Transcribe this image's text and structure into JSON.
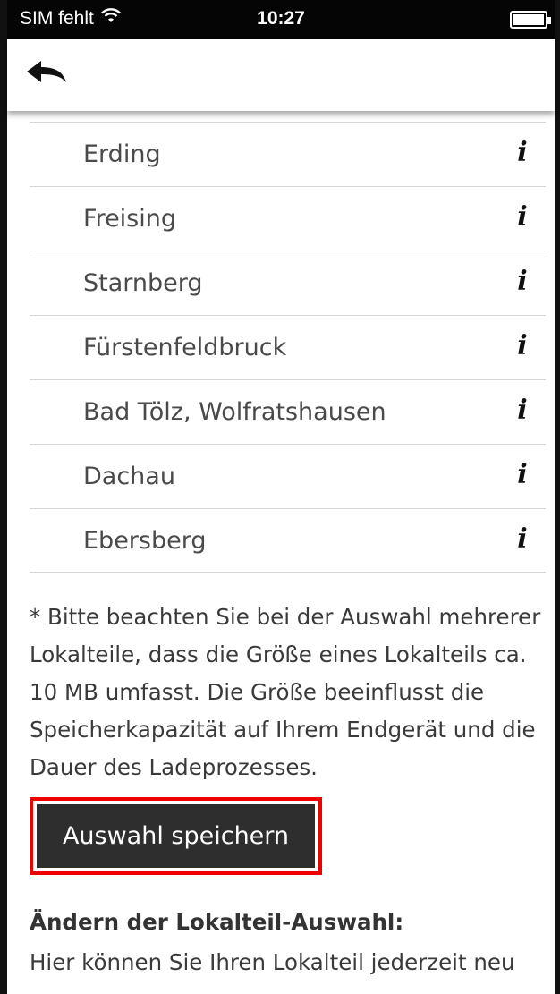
{
  "status_bar": {
    "carrier": "SIM fehlt",
    "time": "10:27"
  },
  "nav": {
    "back_icon": "back-arrow-icon"
  },
  "list": {
    "items": [
      {
        "label": "Erding",
        "info": "i"
      },
      {
        "label": "Freising",
        "info": "i"
      },
      {
        "label": "Starnberg",
        "info": "i"
      },
      {
        "label": "Fürstenfeldbruck",
        "info": "i"
      },
      {
        "label": "Bad Tölz, Wolfratshausen",
        "info": "i"
      },
      {
        "label": "Dachau",
        "info": "i"
      },
      {
        "label": "Ebersberg",
        "info": "i"
      }
    ]
  },
  "note": {
    "lines": [
      "* Bitte beachten Sie bei der Auswahl mehrerer",
      "Lokalteile, dass die Größe eines Lokalteils ca.",
      "10 MB umfasst. Die Größe beeinflusst die",
      "Speicherkapazität auf Ihrem Endgerät und die",
      "Dauer des Ladeprozesses."
    ]
  },
  "actions": {
    "save_label": "Auswahl speichern",
    "highlight_color": "#ee0000"
  },
  "section": {
    "title": "Ändern der Lokalteil-Auswahl:",
    "text": "Hier können Sie Ihren Lokalteil jederzeit neu"
  }
}
